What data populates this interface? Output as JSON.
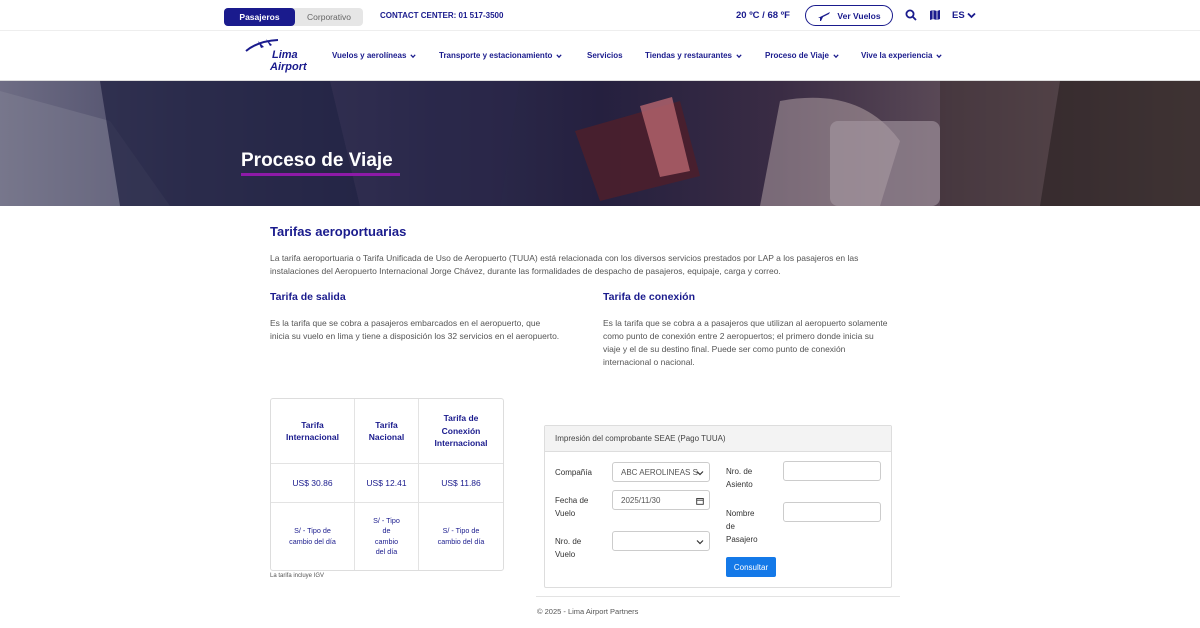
{
  "topbar": {
    "tabs": [
      "Pasajeros",
      "Corporativo"
    ],
    "contact_center": "CONTACT CENTER: 01 517-3500",
    "temperature": "20 ºC  /  68 ºF",
    "ver_vuelos": "Ver Vuelos",
    "language": "ES"
  },
  "logo": {
    "line1": "Lima",
    "line2": "Airport"
  },
  "nav": [
    "Vuelos y aerolíneas",
    "Transporte y estacionamiento",
    "Servicios",
    "Tiendas y restaurantes",
    "Proceso de Viaje",
    "Vive la experiencia"
  ],
  "hero": {
    "title": "Proceso de Viaje"
  },
  "section": {
    "title": "Tarifas aeroportuarias",
    "intro_line1": "La tarifa aeroportuaria o Tarifa Unificada de Uso de Aeropuerto (TUUA) está relacionada con los diversos servicios prestados por LAP a los pasajeros en las",
    "intro_line2": "instalaciones del Aeropuerto Internacional Jorge Chávez, durante las formalidades de despacho de pasajeros, equipaje, carga y correo."
  },
  "salida": {
    "title": "Tarifa de salida",
    "line1": "Es la tarifa que se cobra a pasajeros embarcados en el aeropuerto, que",
    "line2": "inicia su vuelo en lima y tiene a disposición los 32 servicios en el aeropuerto."
  },
  "conexion": {
    "title": "Tarifa de conexión",
    "line1": "Es la tarifa que se cobra a a pasajeros que utilizan al aeropuerto solamente",
    "line2": "como punto de conexión entre 2 aeropuertos; el primero donde inicia su",
    "line3": "viaje y el de su destino final. Puede ser como punto de conexión",
    "line4": "internacional o nacional."
  },
  "fees": {
    "headers": [
      [
        "Tarifa",
        "Internacional"
      ],
      [
        "Tarifa",
        "Nacional"
      ],
      [
        "Tarifa de",
        "Conexión",
        "Internacional"
      ]
    ],
    "prices": [
      "US$ 30.86",
      "US$ 12.41",
      "US$ 11.86"
    ],
    "notes": [
      [
        "S/ - Tipo de",
        "cambio del día"
      ],
      [
        "S/ - Tipo",
        "de",
        "cambio",
        "del día"
      ],
      [
        "S/ - Tipo de",
        "cambio del día"
      ]
    ],
    "footnote": "La tarifa incluye IGV"
  },
  "form": {
    "title": "Impresión del comprobante SEAE (Pago TUUA)",
    "company_label": "Compañía",
    "company_value": "ABC AEROLINEAS S",
    "date_label": [
      "Fecha de",
      "Vuelo"
    ],
    "date_value": "2025/11/30",
    "flight_label": [
      "Nro. de",
      "Vuelo"
    ],
    "flight_value": "",
    "seat_label": [
      "Nro. de",
      "Asiento"
    ],
    "seat_value": "",
    "name_label": [
      "Nombre",
      "de",
      "Pasajero"
    ],
    "name_value": "",
    "submit": "Consultar"
  },
  "footer": {
    "text": "© 2025 - Lima Airport Partners"
  },
  "colors": {
    "brand_navy": "#1a1b8d",
    "accent_purple": "#8e1aa8",
    "button_blue": "#1479e8"
  },
  "icons": [
    "plane-icon",
    "search-icon",
    "map-icon",
    "chevron-down-icon",
    "calendar-icon",
    "lima-airport-logo"
  ]
}
